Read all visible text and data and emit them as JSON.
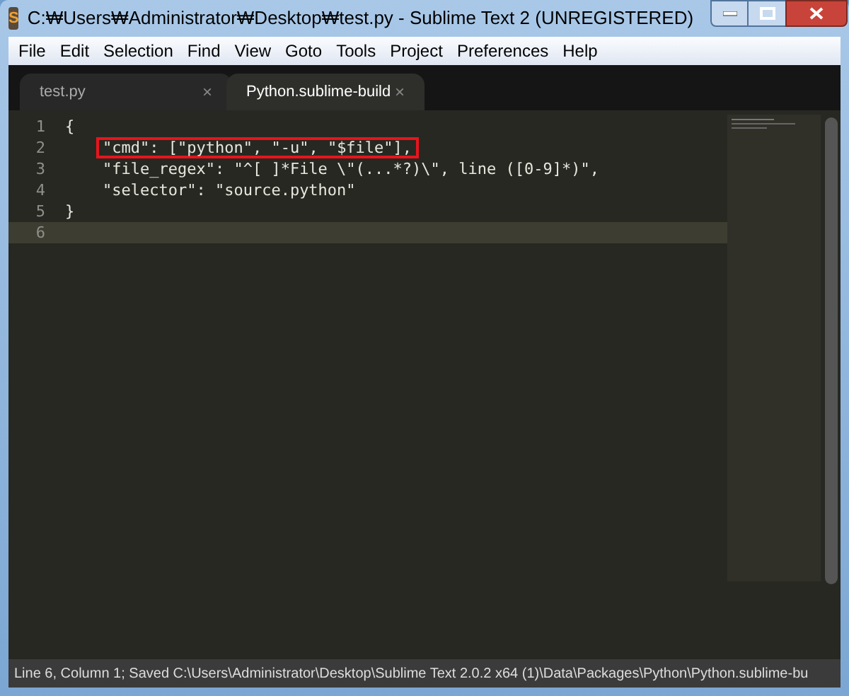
{
  "window": {
    "title": "C:₩Users₩Administrator₩Desktop₩test.py - Sublime Text 2 (UNREGISTERED)",
    "app_icon": "S"
  },
  "menu": [
    "File",
    "Edit",
    "Selection",
    "Find",
    "View",
    "Goto",
    "Tools",
    "Project",
    "Preferences",
    "Help"
  ],
  "tabs": [
    {
      "label": "test.py",
      "selected": false,
      "close": "×"
    },
    {
      "label": "Python.sublime-build",
      "selected": true,
      "close": "×"
    }
  ],
  "editor": {
    "lines": [
      {
        "number": "1",
        "text": "{"
      },
      {
        "number": "2",
        "text": "    \"cmd\": [\"python\", \"-u\", \"$file\"],",
        "highlighted": true
      },
      {
        "number": "3",
        "text": "    \"file_regex\": \"^[ ]*File \\\"(...*?)\\\", line ([0-9]*)\","
      },
      {
        "number": "4",
        "text": "    \"selector\": \"source.python\""
      },
      {
        "number": "5",
        "text": "}"
      },
      {
        "number": "6",
        "current": true
      }
    ]
  },
  "status_bar": "Line 6, Column 1; Saved C:\\Users\\Administrator\\Desktop\\Sublime Text 2.0.2 x64 (1)\\Data\\Packages\\Python\\Python.sublime-bu"
}
